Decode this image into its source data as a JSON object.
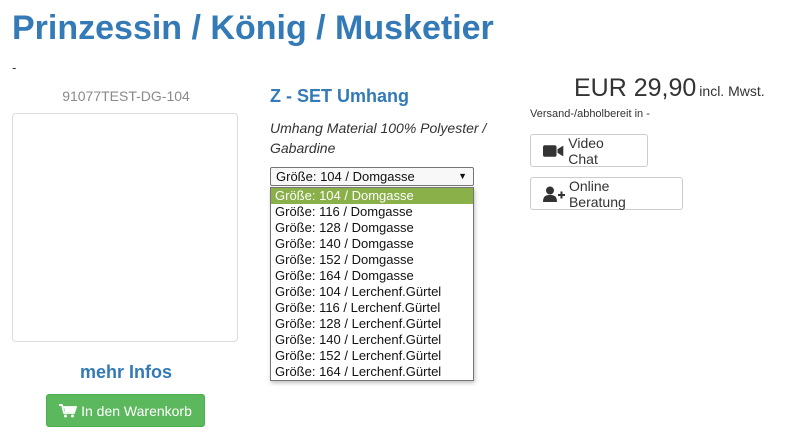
{
  "page": {
    "title": "Prinzessin / König / Musketier",
    "subtitle": "-"
  },
  "product": {
    "sku": "91077TEST-DG-104",
    "name": "Z - SET Umhang",
    "description": "Umhang Material 100% Polyester / Gabardine",
    "more_info_label": "mehr Infos",
    "cart_button_label": "In den Warenkorb",
    "cart_icon": "shopping-cart-icon"
  },
  "size_select": {
    "selected": "Größe: 104 / Domgasse",
    "options": [
      "Größe: 104 / Domgasse",
      "Größe: 116 / Domgasse",
      "Größe: 128 / Domgasse",
      "Größe: 140 / Domgasse",
      "Größe: 152 / Domgasse",
      "Größe: 164 / Domgasse",
      "Größe: 104 / Lerchenf.Gürtel",
      "Größe: 116 / Lerchenf.Gürtel",
      "Größe: 128 / Lerchenf.Gürtel",
      "Größe: 140 / Lerchenf.Gürtel",
      "Größe: 152 / Lerchenf.Gürtel",
      "Größe: 164 / Lerchenf.Gürtel"
    ],
    "highlighted_index": 0
  },
  "pricing": {
    "price": "EUR 29,90",
    "vat_note": "incl. Mwst.",
    "shipping_note": "Versand-/abholbereit in -"
  },
  "actions": {
    "video_chat_label": "Video Chat",
    "video_chat_icon": "video-camera-icon",
    "online_consult_label": "Online Beratung",
    "online_consult_icon": "user-plus-icon"
  },
  "colors": {
    "link_blue": "#337ab7",
    "cart_green": "#5cb85c",
    "option_highlight": "#8ab04a"
  }
}
